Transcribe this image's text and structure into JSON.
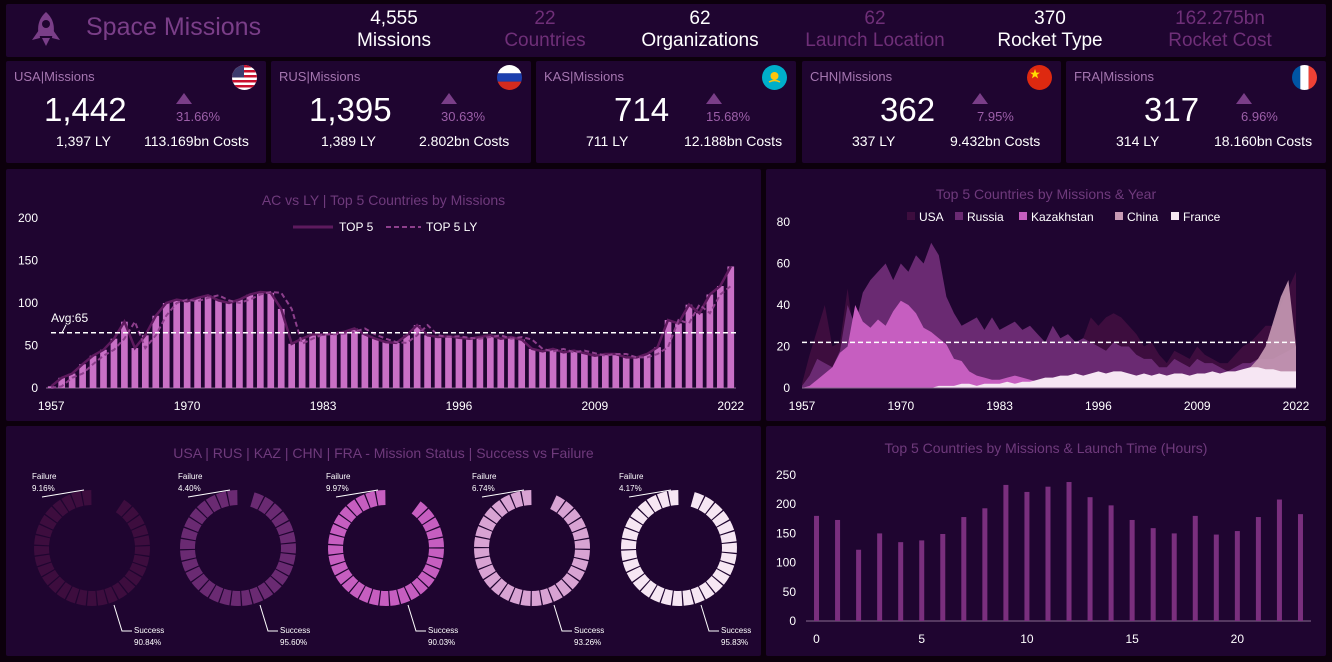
{
  "header": {
    "title": "Space Missions",
    "stats": [
      {
        "value": "4,555",
        "label": "Missions",
        "bright": true
      },
      {
        "value": "22",
        "label": "Countries",
        "bright": false
      },
      {
        "value": "62",
        "label": "Organizations",
        "bright": true
      },
      {
        "value": "62",
        "label": "Launch Location",
        "bright": false
      },
      {
        "value": "370",
        "label": "Rocket Type",
        "bright": true
      },
      {
        "value": "162.275bn",
        "label": "Rocket Cost",
        "bright": false
      }
    ]
  },
  "kpis": [
    {
      "title": "USA|Missions",
      "value": "1,442",
      "pct": "31.66%",
      "ly": "1,397 LY",
      "cost": "113.169bn Costs",
      "flag": "usa"
    },
    {
      "title": "RUS|Missions",
      "value": "1,395",
      "pct": "30.63%",
      "ly": "1,389 LY",
      "cost": "2.802bn Costs",
      "flag": "rus"
    },
    {
      "title": "KAS|Missions",
      "value": "714",
      "pct": "15.68%",
      "ly": "711 LY",
      "cost": "12.188bn Costs",
      "flag": "kaz"
    },
    {
      "title": "CHN|Missions",
      "value": "362",
      "pct": "7.95%",
      "ly": "337 LY",
      "cost": "9.432bn Costs",
      "flag": "chn"
    },
    {
      "title": "FRA|Missions",
      "value": "317",
      "pct": "6.96%",
      "ly": "314 LY",
      "cost": "18.160bn Costs",
      "flag": "fra"
    }
  ],
  "colors": {
    "bar": "#c970c6",
    "line": "#5e1a5e",
    "usa": "#3d0d3e",
    "russia": "#6a2a72",
    "kazakhstan": "#c65ec0",
    "china": "#c89ab5",
    "france": "#f6e6f3"
  },
  "chart_data": [
    {
      "type": "bar",
      "title": "AC vs LY | Top 5 Countries by Missions",
      "legend": [
        "TOP 5",
        "TOP 5 LY"
      ],
      "avg_label": "Avg:65",
      "avg": 65,
      "ylim": [
        0,
        200
      ],
      "yticks": [
        0,
        50,
        100,
        150,
        200
      ],
      "xticks": [
        1957,
        1970,
        1983,
        1996,
        2009,
        2022
      ],
      "x": [
        1957,
        1958,
        1959,
        1960,
        1961,
        1962,
        1963,
        1964,
        1965,
        1966,
        1967,
        1968,
        1969,
        1970,
        1971,
        1972,
        1973,
        1974,
        1975,
        1976,
        1977,
        1978,
        1979,
        1980,
        1981,
        1982,
        1983,
        1984,
        1985,
        1986,
        1987,
        1988,
        1989,
        1990,
        1991,
        1992,
        1993,
        1994,
        1995,
        1996,
        1997,
        1998,
        1999,
        2000,
        2001,
        2002,
        2003,
        2004,
        2005,
        2006,
        2007,
        2008,
        2009,
        2010,
        2011,
        2012,
        2013,
        2014,
        2015,
        2016,
        2017,
        2018,
        2019,
        2020,
        2021,
        2022
      ],
      "series": [
        {
          "name": "TOP 5",
          "values": [
            2,
            12,
            17,
            28,
            38,
            45,
            58,
            78,
            47,
            62,
            85,
            100,
            104,
            102,
            106,
            109,
            103,
            100,
            104,
            110,
            113,
            112,
            93,
            52,
            58,
            63,
            63,
            64,
            66,
            70,
            63,
            58,
            54,
            53,
            62,
            74,
            62,
            60,
            61,
            59,
            58,
            60,
            62,
            58,
            60,
            57,
            46,
            43,
            46,
            42,
            44,
            41,
            38,
            40,
            40,
            36,
            36,
            40,
            48,
            80,
            76,
            98,
            88,
            110,
            120,
            143
          ]
        },
        {
          "name": "TOP 5 LY",
          "values": [
            0,
            2,
            12,
            17,
            28,
            38,
            45,
            58,
            78,
            47,
            62,
            85,
            100,
            104,
            102,
            106,
            109,
            103,
            100,
            104,
            110,
            113,
            112,
            93,
            52,
            58,
            63,
            63,
            64,
            66,
            70,
            63,
            58,
            54,
            53,
            62,
            74,
            62,
            60,
            61,
            59,
            58,
            60,
            62,
            58,
            60,
            57,
            46,
            43,
            46,
            42,
            44,
            41,
            38,
            40,
            40,
            36,
            36,
            40,
            48,
            80,
            76,
            98,
            88,
            110,
            120
          ]
        }
      ]
    },
    {
      "type": "area",
      "title": "Top 5 Countries by Missions & Year",
      "ylim": [
        0,
        80
      ],
      "yticks": [
        0,
        20,
        40,
        60,
        80
      ],
      "xticks": [
        1957,
        1970,
        1983,
        1996,
        2009,
        2022
      ],
      "avg": 22,
      "x": [
        1957,
        1958,
        1959,
        1960,
        1961,
        1962,
        1963,
        1964,
        1965,
        1966,
        1967,
        1968,
        1969,
        1970,
        1971,
        1972,
        1973,
        1974,
        1975,
        1976,
        1977,
        1978,
        1979,
        1980,
        1981,
        1982,
        1983,
        1984,
        1985,
        1986,
        1987,
        1988,
        1989,
        1990,
        1991,
        1992,
        1993,
        1994,
        1995,
        1996,
        1997,
        1998,
        1999,
        2000,
        2001,
        2002,
        2003,
        2004,
        2005,
        2006,
        2007,
        2008,
        2009,
        2010,
        2011,
        2012,
        2013,
        2014,
        2015,
        2016,
        2017,
        2018,
        2019,
        2020,
        2021,
        2022
      ],
      "series": [
        {
          "name": "USA",
          "values": [
            2,
            16,
            28,
            40,
            20,
            22,
            48,
            20,
            30,
            42,
            46,
            38,
            36,
            40,
            34,
            42,
            44,
            36,
            36,
            32,
            30,
            30,
            24,
            20,
            20,
            24,
            24,
            28,
            24,
            28,
            24,
            22,
            22,
            24,
            20,
            24,
            22,
            24,
            34,
            30,
            34,
            36,
            34,
            30,
            26,
            20,
            22,
            16,
            12,
            18,
            16,
            14,
            20,
            16,
            14,
            12,
            12,
            16,
            20,
            22,
            26,
            30,
            30,
            40,
            48,
            56
          ]
        },
        {
          "name": "Russia",
          "values": [
            1,
            6,
            14,
            12,
            10,
            18,
            40,
            30,
            46,
            52,
            56,
            60,
            52,
            60,
            56,
            64,
            60,
            70,
            64,
            44,
            36,
            30,
            32,
            34,
            28,
            34,
            28,
            30,
            32,
            28,
            30,
            26,
            22,
            30,
            24,
            26,
            22,
            24,
            22,
            20,
            18,
            22,
            20,
            20,
            16,
            14,
            14,
            10,
            10,
            14,
            12,
            10,
            14,
            12,
            12,
            10,
            8,
            10,
            12,
            12,
            14,
            14,
            14,
            16,
            18,
            20
          ]
        },
        {
          "name": "Kazakhstan",
          "values": [
            0,
            1,
            4,
            7,
            10,
            17,
            20,
            40,
            32,
            29,
            33,
            30,
            37,
            42,
            40,
            36,
            29,
            27,
            24,
            21,
            14,
            13,
            8,
            6,
            5,
            4,
            4,
            5,
            6,
            5,
            4,
            3,
            4,
            4,
            3,
            3,
            3,
            2,
            2,
            2,
            2,
            2,
            2,
            2,
            2,
            2,
            2,
            1,
            1,
            1,
            1,
            1,
            1,
            1,
            1,
            1,
            1,
            1,
            1,
            1,
            1,
            1,
            1,
            1,
            1,
            1
          ]
        },
        {
          "name": "China",
          "values": [
            0,
            0,
            0,
            0,
            0,
            0,
            0,
            0,
            0,
            0,
            0,
            0,
            0,
            0,
            0,
            0,
            0,
            0,
            0,
            0,
            0,
            0,
            0,
            0,
            0,
            0,
            0,
            0,
            0,
            0,
            0,
            0,
            0,
            0,
            0,
            0,
            0,
            0,
            0,
            0,
            0,
            0,
            0,
            0,
            0,
            0,
            0,
            0,
            0,
            0,
            0,
            0,
            0,
            0,
            0,
            0,
            0,
            2,
            4,
            10,
            14,
            20,
            32,
            44,
            52,
            20
          ]
        },
        {
          "name": "France",
          "values": [
            0,
            0,
            0,
            0,
            0,
            0,
            0,
            0,
            0,
            0,
            0,
            0,
            0,
            0,
            0,
            0,
            0,
            0,
            1,
            1,
            1,
            2,
            2,
            1,
            2,
            2,
            2,
            3,
            2,
            3,
            3,
            4,
            5,
            5,
            6,
            6,
            7,
            6,
            7,
            8,
            7,
            8,
            8,
            7,
            6,
            7,
            6,
            7,
            6,
            7,
            7,
            6,
            7,
            7,
            8,
            7,
            8,
            8,
            9,
            10,
            10,
            9,
            9,
            8,
            8,
            8
          ]
        }
      ]
    },
    {
      "type": "pie",
      "title": "USA | RUS | KAZ | CHN | FRA - Mission Status | Success vs Failure",
      "label_failure": "Failure",
      "label_success": "Success",
      "donuts": [
        {
          "country": "USA",
          "failure_label": "9.16%",
          "success_label": "90.84%",
          "failure": 9.16,
          "success": 90.84,
          "color": "#3d0d3e"
        },
        {
          "country": "RUS",
          "failure_label": "4.40%",
          "success_label": "95.60%",
          "failure": 4.4,
          "success": 95.6,
          "color": "#6a2a72"
        },
        {
          "country": "KAZ",
          "failure_label": "9.97%",
          "success_label": "90.03%",
          "failure": 9.97,
          "success": 90.03,
          "color": "#c65ec0"
        },
        {
          "country": "CHN",
          "failure_label": "6.74%",
          "success_label": "93.26%",
          "failure": 6.74,
          "success": 93.26,
          "color": "#d8a3d3"
        },
        {
          "country": "FRA",
          "failure_label": "4.17%",
          "success_label": "95.83%",
          "failure": 4.17,
          "success": 95.83,
          "color": "#f6e6f3"
        }
      ]
    },
    {
      "type": "bar",
      "title": "Top 5 Countries by Missions & Launch Time (Hours)",
      "ylim": [
        0,
        250
      ],
      "yticks": [
        0,
        50,
        100,
        150,
        200,
        250
      ],
      "xticks": [
        0,
        5,
        10,
        15,
        20
      ],
      "categories": [
        0,
        1,
        2,
        3,
        4,
        5,
        6,
        7,
        8,
        9,
        10,
        11,
        12,
        13,
        14,
        15,
        16,
        17,
        18,
        19,
        20,
        21,
        22,
        23
      ],
      "values": [
        180,
        173,
        122,
        150,
        135,
        138,
        149,
        178,
        193,
        233,
        221,
        230,
        238,
        212,
        198,
        173,
        159,
        150,
        180,
        148,
        154,
        178,
        208,
        183
      ]
    }
  ]
}
